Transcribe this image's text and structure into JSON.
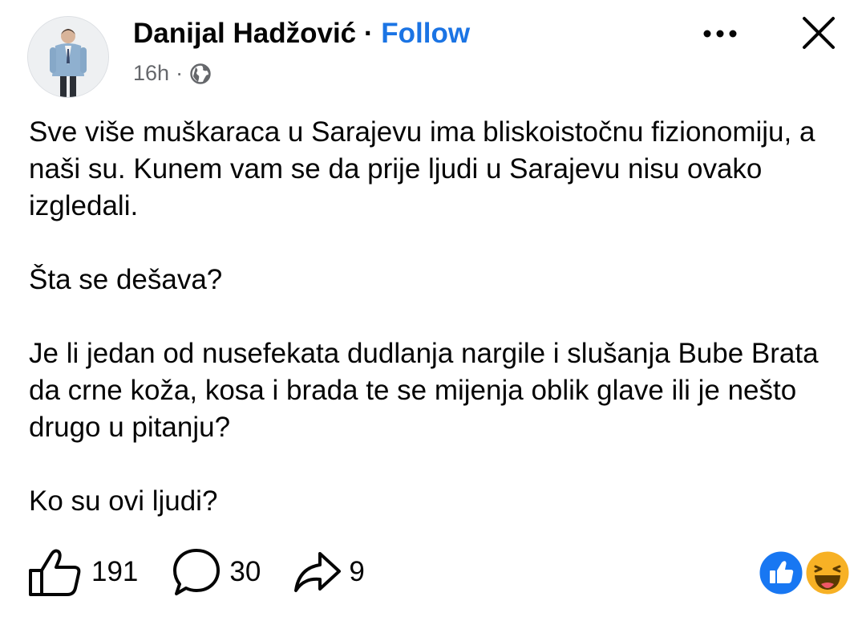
{
  "post": {
    "author": "Danijal Hadžović",
    "separator": "·",
    "follow_label": "Follow",
    "time": "16h",
    "time_separator": "·",
    "audience_icon": "globe-icon",
    "paragraphs": [
      "Sve više muškaraca u Sarajevu ima bliskoistočnu fizionomiju, a naši su. Kunem vam se da prije ljudi u Sarajevu nisu ovako izgledali.",
      "Šta se dešava?",
      "Je li jedan od nusefekata dudlanja nargile i slušanja Bube Brata da crne koža, kosa i brada te se mijenja oblik glave ili je nešto drugo u pitanju?",
      "Ko su ovi ljudi?"
    ]
  },
  "stats": {
    "likes": "191",
    "comments": "30",
    "shares": "9"
  },
  "icons": {
    "more": "more-horizontal-icon",
    "close": "close-icon",
    "like": "thumbs-up-icon",
    "comment": "comment-icon",
    "share": "share-icon",
    "reaction_like": "like-reaction-icon",
    "reaction_haha": "haha-reaction-icon"
  },
  "colors": {
    "follow": "#1b74e4",
    "text": "#050505",
    "meta": "#65676b",
    "like_reaction": "#1877f2",
    "haha_reaction": "#f7b125"
  }
}
